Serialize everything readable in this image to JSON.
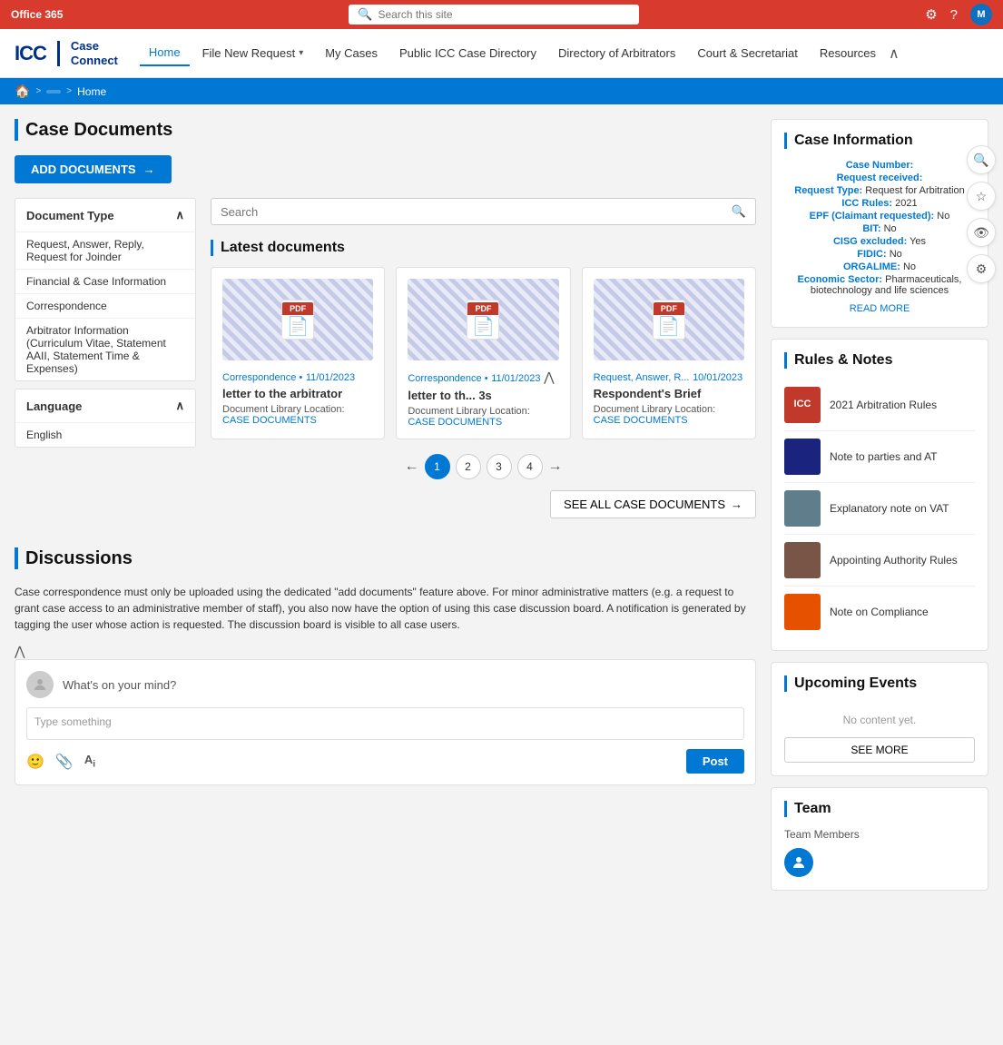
{
  "topbar": {
    "app_name": "Office 365",
    "search_placeholder": "Search this site",
    "avatar_label": "M"
  },
  "nav": {
    "logo_icc": "ICC",
    "logo_app": "Case\nConnect",
    "links": [
      {
        "label": "Home",
        "has_dropdown": false
      },
      {
        "label": "File New Request",
        "has_dropdown": true
      },
      {
        "label": "My Cases",
        "has_dropdown": false
      },
      {
        "label": "Public ICC Case Directory",
        "has_dropdown": false
      },
      {
        "label": "Directory of Arbitrators",
        "has_dropdown": false
      },
      {
        "label": "Court & Secretariat",
        "has_dropdown": false
      },
      {
        "label": "Resources",
        "has_dropdown": false
      }
    ]
  },
  "breadcrumb": {
    "home_icon": "🏠",
    "crumb_label": "Home"
  },
  "case_documents": {
    "title": "Case Documents",
    "add_btn": "ADD DOCUMENTS",
    "search_placeholder": "Search",
    "filter_groups": [
      {
        "label": "Document Type",
        "items": [
          "Request, Answer, Reply, Request for Joinder",
          "Financial & Case Information",
          "Correspondence",
          "Arbitrator Information (Curriculum Vitae, Statement AAII, Statement Time & Expenses)"
        ]
      },
      {
        "label": "Language",
        "items": [
          "English"
        ]
      }
    ],
    "latest_title": "Latest documents",
    "documents": [
      {
        "tag": "Correspondence •",
        "date": "11/01/2023",
        "name": "letter to the arbitrator",
        "location_label": "Document Library Location:",
        "location_link": "CASE DOCUMENTS"
      },
      {
        "tag": "Correspondence •",
        "date": "11/01/2023",
        "name": "letter to th... 3s",
        "location_label": "Document Library Location:",
        "location_link": "CASE DOCUMENTS"
      },
      {
        "tag": "Request, Answer, R...",
        "date": "10/01/2023",
        "name": "Respondent's Brief",
        "location_label": "Document Library Location:",
        "location_link": "CASE DOCUMENTS"
      }
    ],
    "pagination": [
      1,
      2,
      3,
      4
    ],
    "see_all_label": "SEE ALL CASE DOCUMENTS"
  },
  "discussions": {
    "title": "Discussions",
    "body_text": "Case correspondence must only be uploaded using the dedicated \"add documents\" feature above. For minor administrative matters (e.g. a request to grant case access to an administrative member of staff), you also now have the option of using this case discussion board. A notification is generated by tagging the user whose action is requested. The discussion board is visible to all case users.",
    "input_placeholder": "What's on your mind?",
    "textarea_placeholder": "Type something",
    "post_btn": "Post"
  },
  "case_info": {
    "title": "Case Information",
    "rows": [
      {
        "label": "Case Number:",
        "value": ""
      },
      {
        "label": "Request received:",
        "value": ""
      },
      {
        "label": "Request Type:",
        "value": "Request for Arbitration"
      },
      {
        "label": "ICC Rules:",
        "value": "2021"
      },
      {
        "label": "EPF (Claimant requested):",
        "value": "No"
      },
      {
        "label": "BIT:",
        "value": "No"
      },
      {
        "label": "CISG excluded:",
        "value": "Yes"
      },
      {
        "label": "FIDIC:",
        "value": "No"
      },
      {
        "label": "ORGALIME:",
        "value": "No"
      },
      {
        "label": "Economic Sector:",
        "value": "Pharmaceuticals, biotechnology and life sciences"
      }
    ],
    "read_more": "READ MORE"
  },
  "rules_notes": {
    "title": "Rules & Notes",
    "items": [
      {
        "label": "2021 Arbitration Rules",
        "color": "red"
      },
      {
        "label": "Note to parties and AT",
        "color": "blue"
      },
      {
        "label": "Explanatory note on VAT",
        "color": "gray"
      },
      {
        "label": "Appointing Authority Rules",
        "color": "brown"
      },
      {
        "label": "Note on Compliance",
        "color": "orange"
      }
    ]
  },
  "upcoming_events": {
    "title": "Upcoming Events",
    "no_content": "No content yet.",
    "see_more_btn": "SEE MORE"
  },
  "team": {
    "title": "Team",
    "members_label": "Team Members"
  },
  "floating_icons": [
    "🔍",
    "☆",
    "👁",
    "⚙"
  ]
}
